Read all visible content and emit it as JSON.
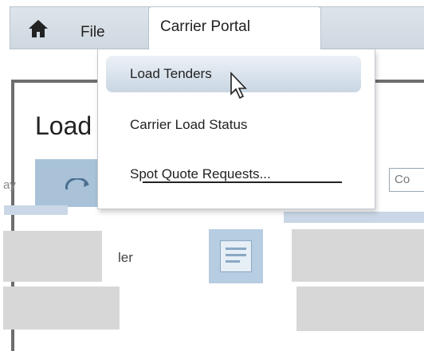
{
  "navbar": {
    "home_icon": "home-icon",
    "file_label": "File",
    "portal_label": "Carrier Portal"
  },
  "menu": {
    "items": [
      {
        "label": "Load Tenders",
        "state": "hover"
      },
      {
        "label": "Carrier Load Status"
      },
      {
        "label": "Spot Quote Requests..."
      }
    ]
  },
  "page": {
    "title": "Load",
    "side_fragment": "ay",
    "filter_value": "Co",
    "row_fragment": "ler"
  },
  "colors": {
    "navbar": "#d6dde5",
    "menu_hover": "#c9d6e3",
    "panel_border": "#6e6e6e",
    "tile_blue": "#a9c2d8"
  }
}
